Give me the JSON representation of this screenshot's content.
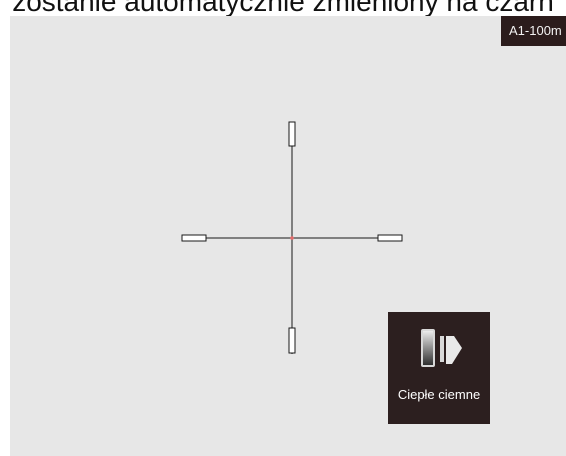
{
  "caption": {
    "text": "zostanie automatycznie zmieniony na czarn"
  },
  "badge": {
    "range_label": "A1-100m"
  },
  "palette": {
    "label": "Ciepłe ciemne",
    "icon": "palette-switch-icon"
  },
  "colors": {
    "view_background": "#e7e7e7",
    "badge_background": "#2b1c1c",
    "card_background": "#2c1f1f",
    "reticle_line": "#1a1a1a",
    "center_dot": "#e46a6a"
  }
}
